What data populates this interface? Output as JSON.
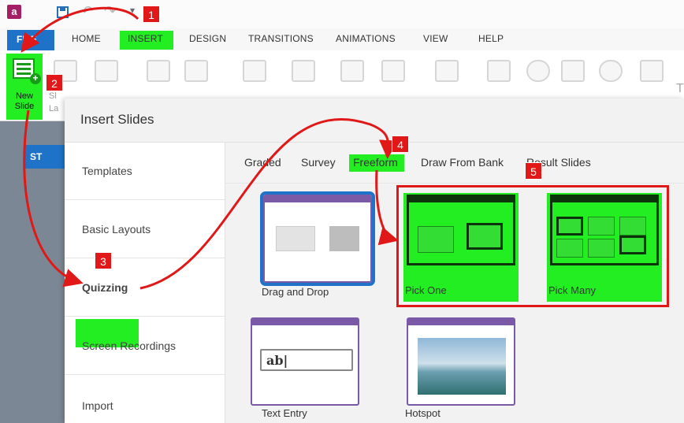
{
  "app": {
    "logo_letter": "a"
  },
  "quick_access": {
    "undo_glyph": "↶",
    "redo_glyph": "↷",
    "dropdown_glyph": "▾"
  },
  "ribbon_tabs": {
    "file": "FILE",
    "items": [
      "HOME",
      "INSERT",
      "DESIGN",
      "TRANSITIONS",
      "ANIMATIONS",
      "VIEW",
      "HELP"
    ]
  },
  "ribbon": {
    "new_slide_line1": "New",
    "new_slide_line2": "Slide",
    "slide_label_fragment": "Sl",
    "layout_label_fragment": "La",
    "right_fragment": "T"
  },
  "left_panel": {
    "active_tab": "ST"
  },
  "dialog": {
    "title": "Insert Slides",
    "categories": [
      "Templates",
      "Basic Layouts",
      "Quizzing",
      "Screen Recordings",
      "Import"
    ],
    "subtabs": [
      "Graded",
      "Survey",
      "Freeform",
      "Draw From Bank",
      "Result Slides"
    ],
    "templates": [
      {
        "label": "Drag and Drop"
      },
      {
        "label": "Pick One"
      },
      {
        "label": "Pick Many"
      },
      {
        "label": "Text Entry",
        "field_text": "ab|"
      },
      {
        "label": "Hotspot"
      }
    ]
  },
  "annotations": {
    "colors": {
      "highlight": "#22ee22",
      "callout": "#e01818",
      "accent": "#1e73c8"
    },
    "badges": [
      "1",
      "2",
      "3",
      "4",
      "5"
    ]
  }
}
